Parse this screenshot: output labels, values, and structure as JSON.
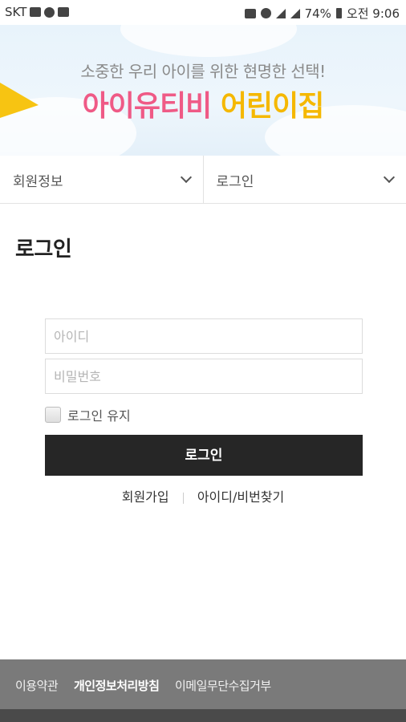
{
  "status_bar": {
    "carrier": "SKT",
    "battery": "74%",
    "time": "오전 9:06"
  },
  "banner": {
    "subtitle": "소중한 우리 아이를 위한 현명한 선택!",
    "title_part1": "아이유티비",
    "title_part2": "어린이집",
    "colors": {
      "part1": "#ef5a86",
      "part2": "#f5b800"
    }
  },
  "nav": {
    "left_dropdown": "회원정보",
    "right_dropdown": "로그인"
  },
  "page": {
    "title": "로그인"
  },
  "form": {
    "id_placeholder": "아이디",
    "pw_placeholder": "비밀번호",
    "keep_login": "로그인 유지",
    "submit": "로그인",
    "signup": "회원가입",
    "find": "아이디/비번찾기"
  },
  "footer": {
    "terms": "이용약관",
    "privacy": "개인정보처리방침",
    "email_refuse": "이메일무단수집거부"
  }
}
